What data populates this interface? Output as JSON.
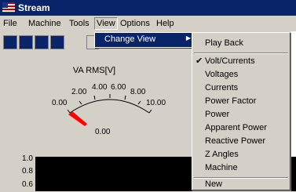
{
  "window": {
    "title": "Stream"
  },
  "menubar": {
    "items": [
      "File",
      "Machine",
      "Tools",
      "View",
      "Options",
      "Help"
    ]
  },
  "submenu": {
    "change_view": "Change View"
  },
  "dropdown": {
    "items": [
      {
        "label": "Play Back",
        "checked": false
      },
      {
        "label": "Volt/Currents",
        "checked": true
      },
      {
        "label": "Voltages",
        "checked": false
      },
      {
        "label": "Currents",
        "checked": false
      },
      {
        "label": "Power Factor",
        "checked": false
      },
      {
        "label": "Power",
        "checked": false
      },
      {
        "label": "Apparent Power",
        "checked": false
      },
      {
        "label": "Reactive Power",
        "checked": false
      },
      {
        "label": "Z Angles",
        "checked": false
      },
      {
        "label": "Machine",
        "checked": false
      },
      {
        "label": "New",
        "checked": false
      }
    ]
  },
  "gauge": {
    "title": "VA RMS[V]",
    "ticks": [
      "0.00",
      "2.00",
      "4.00",
      "6.00",
      "8.00",
      "10.00"
    ],
    "value": "0.00"
  },
  "chart": {
    "ylabels": [
      "1.0",
      "0.8",
      "0.6"
    ]
  },
  "colors": {
    "titlebar": "#0a246a",
    "needle": "#ff0000",
    "window_bg": "#d4d0c8"
  }
}
